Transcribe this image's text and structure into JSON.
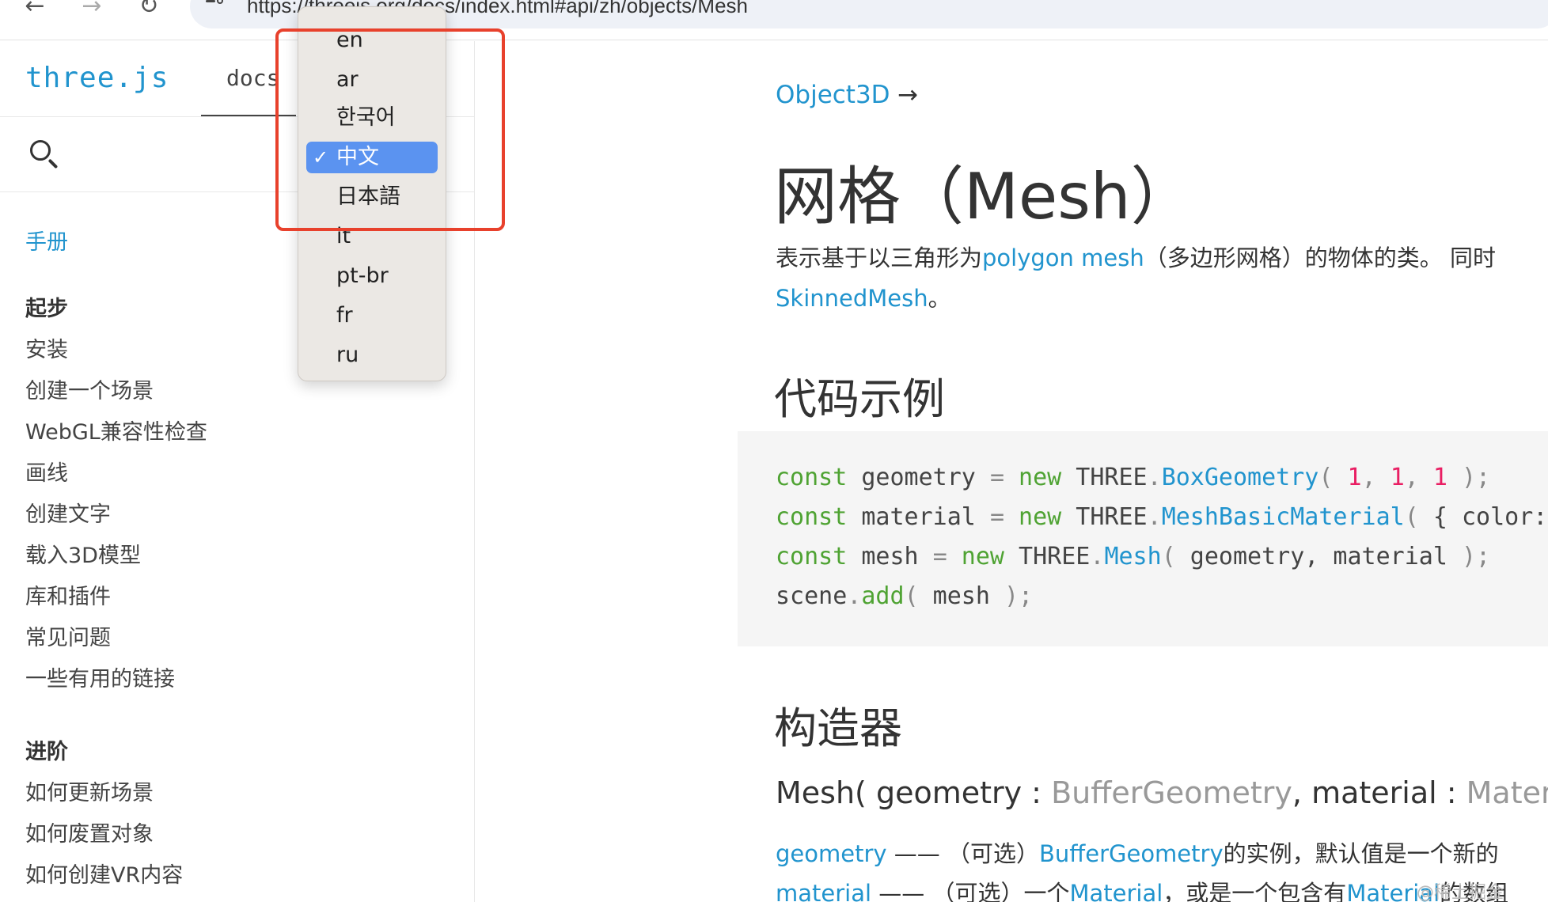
{
  "browser": {
    "back_glyph": "←",
    "forward_glyph": "→",
    "reload_glyph": "↻",
    "url": "https://threejs.org/docs/index.html#api/zh/objects/Mesh"
  },
  "sidebar": {
    "brand": "three.js",
    "tab_docs": "docs",
    "tab_examples": "s",
    "manual": "手册",
    "groups": [
      {
        "title": "起步",
        "items": [
          "安装",
          "创建一个场景",
          "WebGL兼容性检查",
          "画线",
          "创建文字",
          "载入3D模型",
          "库和插件",
          "常见问题",
          "一些有用的链接"
        ]
      },
      {
        "title": "进阶",
        "items": [
          "如何更新场景",
          "如何废置对象",
          "如何创建VR内容"
        ]
      }
    ]
  },
  "language_dropdown": {
    "selected": "中文",
    "check_glyph": "✓",
    "options": [
      "en",
      "ar",
      "한국어",
      "中文",
      "日本語",
      "it",
      "pt-br",
      "fr",
      "ru"
    ]
  },
  "content": {
    "breadcrumb": "Object3D",
    "breadcrumb_arrow": "→",
    "title": "网格（Mesh）",
    "desc_pre": "表示基于以三角形为",
    "desc_link": "polygon mesh",
    "desc_post": "（多边形网格）的物体的类。 同时",
    "desc_link2": "SkinnedMesh",
    "desc_end": "。",
    "code_heading": "代码示例",
    "code": {
      "l1": {
        "kw": "const",
        "name": " geometry ",
        "eq": "=",
        "kw2": " new",
        "cls": " THREE",
        "dot": ".",
        "fn": "BoxGeometry",
        "args": [
          "1",
          "1",
          "1"
        ]
      },
      "l2": {
        "kw": "const",
        "name": " material ",
        "eq": "=",
        "kw2": " new",
        "cls": " THREE",
        "dot": ".",
        "fn": "MeshBasicMaterial",
        "rest": " { color:"
      },
      "l3": {
        "kw": "const",
        "name": " mesh ",
        "eq": "=",
        "kw2": " new",
        "cls": " THREE",
        "dot": ".",
        "fn": "Mesh",
        "rest": " geometry, material "
      },
      "l4": {
        "obj": "scene",
        "dot": ".",
        "fn": "add",
        "rest": " mesh "
      }
    },
    "ctor_heading": "构造器",
    "signature": {
      "name": "Mesh( geometry : ",
      "type1": "BufferGeometry",
      "mid": ", material : ",
      "type2": "Materi"
    },
    "params": [
      {
        "name": "geometry",
        "dash": " —— （可选）",
        "link": "BufferGeometry",
        "text": "的实例，默认值是一个新的"
      },
      {
        "name": "material",
        "dash": " —— （可选）一个",
        "link": "Material",
        "text": "，或是一个包含有",
        "link2": "Material",
        "text2": "的数组"
      }
    ],
    "watermark": "@稀土掘金"
  }
}
